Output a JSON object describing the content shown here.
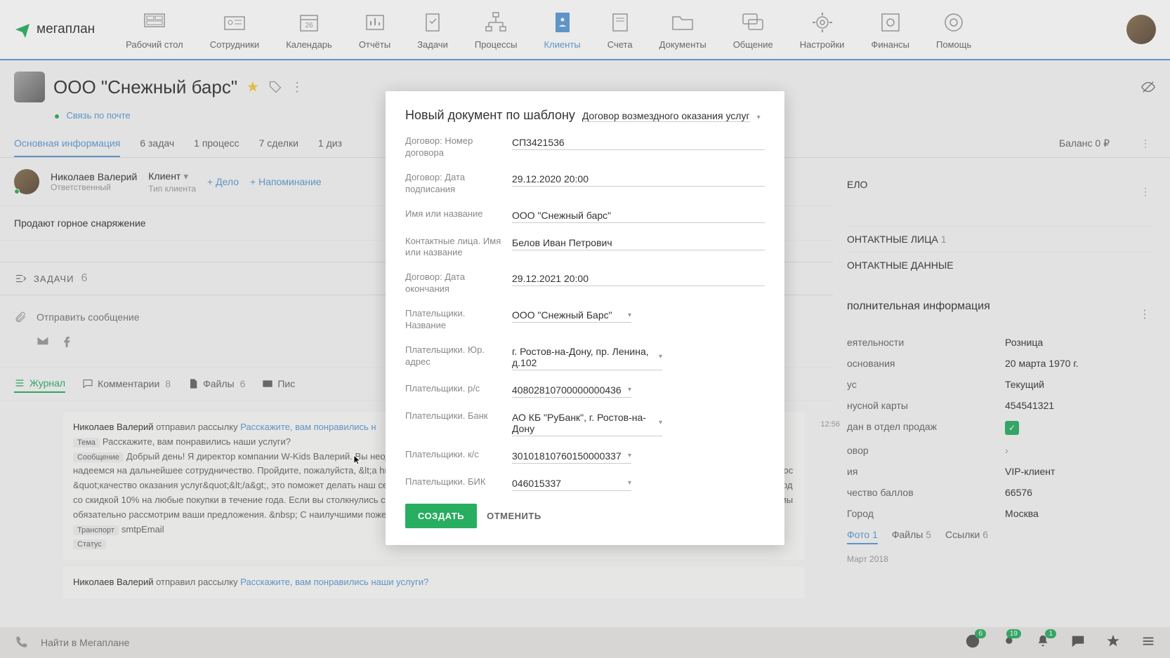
{
  "brand": "мегаплан",
  "nav": {
    "items": [
      {
        "label": "Рабочий стол"
      },
      {
        "label": "Сотрудники"
      },
      {
        "label": "Календарь"
      },
      {
        "label": "Отчёты"
      },
      {
        "label": "Задачи"
      },
      {
        "label": "Процессы"
      },
      {
        "label": "Клиенты"
      },
      {
        "label": "Счета"
      },
      {
        "label": "Документы"
      },
      {
        "label": "Общение"
      },
      {
        "label": "Настройки"
      },
      {
        "label": "Финансы"
      },
      {
        "label": "Помощь"
      }
    ]
  },
  "calendar_badge": "26",
  "client": {
    "name": "ООО \"Снежный барс\"",
    "mail_link": "Связь по почте"
  },
  "tabs": {
    "main": "Основная информация",
    "tasks": "6 задач",
    "process": "1 процесс",
    "deals": "7 сделки",
    "design": "1 диз",
    "balance": "Баланс 0 ₽"
  },
  "responsible": {
    "name": "Николаев Валерий",
    "role": "Ответственный",
    "client_label": "Клиент",
    "client_type": "Тип клиента",
    "add_deal": "+ Дело",
    "add_reminder": "+ Напоминание"
  },
  "description": "Продают горное снаряжение",
  "tasks_section": {
    "label": "ЗАДАЧИ",
    "count": "6"
  },
  "message_placeholder": "Отправить сообщение",
  "feed_tabs": {
    "journal": "Журнал",
    "comments": "Комментарии",
    "comments_count": "8",
    "files": "Файлы",
    "files_count": "6",
    "mail": "Пис"
  },
  "journal": {
    "entry1": {
      "user": "Николаев Валерий",
      "action": " отправил рассылку ",
      "link": "Расскажите, вам понравились н",
      "topic_label": "Тема",
      "topic": "Расскажите, вам понравились наши услуги?",
      "msg_label": "Сообщение",
      "body": "Добрый день! Я директор компании W-Kids Валерий. Вы неоднократно приобретали наши товары. Мы рады, что вы выбрали именно нашу компанию и надеемся на дальнейшее сотрудничество. Пройдите, пожалуйста, &lt;a href=\"https://docs.google.com/forms/d/1e-XG_R9hN0ja5oSlPZ5Vom5nPBBvnoyUomaz_vor.ag\" опрос &quot;качество оказания услуг&quot;&lt;/a&gt;, это поможет делать наш сервис более удобным, а в подарок за потраченное время в конце опроса вы получите промокод со скидкой 10% на любые покупки в течение года. Если вы столкнулись с какими-то проблемами или хотели бы что-то улучшить, то можете ответить на это письмо и мы обязательно рассмотрим ваши предложения. &nbsp; С наилучшими пожеланиями!",
      "transport_label": "Транспорт",
      "transport": "smtpEmail",
      "status_label": "Статус",
      "time": "12:56"
    },
    "entry2": {
      "user": "Николаев Валерий",
      "action": " отправил рассылку ",
      "link": "Расскажите, вам понравились наши услуги?"
    }
  },
  "right": {
    "delo_label": "ЕЛО",
    "contacts_label": "ОНТАКТНЫЕ ЛИЦА",
    "contacts_count": "1",
    "contact_data_label": "ОНТАКТНЫЕ ДАННЫЕ",
    "info_title": "полнительная информация",
    "rows": {
      "activity_label": "еятельности",
      "activity": "Розница",
      "founded_label": "основания",
      "founded": "20 марта 1970 г.",
      "status_label": "ус",
      "status": "Текущий",
      "bonus_label": "нусной карты",
      "bonus": "454541321",
      "sales_label": "дан в отдел продаж",
      "contract_label": "овор",
      "category_label": "ия",
      "category": "VIP-клиент",
      "points_label": "чество баллов",
      "points": "66576",
      "city_label": "Город",
      "city": "Москва"
    },
    "file_tabs": {
      "photo": "Фото",
      "photo_n": "1",
      "files": "Файлы",
      "files_n": "5",
      "links": "Ссылки",
      "links_n": "6"
    },
    "date_group": "Март 2018"
  },
  "modal": {
    "title": "Новый документ по шаблону",
    "template": "Договор возмездного оказания услуг",
    "fields": {
      "number_label": "Договор: Номер договора",
      "number": "СП3421536",
      "sign_date_label": "Договор: Дата подписания",
      "sign_date": "29.12.2020 20:00",
      "name_label": "Имя или название",
      "name": "ООО \"Снежный барс\"",
      "contact_label": "Контактные лица. Имя или название",
      "contact": "Белов Иван Петрович",
      "end_date_label": "Договор: Дата окончания",
      "end_date": "29.12.2021 20:00",
      "payer_name_label": "Плательщики. Название",
      "payer_name": "ООО \"Снежный Барс\"",
      "payer_addr_label": "Плательщики. Юр. адрес",
      "payer_addr": "г. Ростов-на-Дону, пр. Ленина, д.102",
      "payer_acc_label": "Плательщики. р/с",
      "payer_acc": "40802810700000000436",
      "payer_bank_label": "Плательщики. Банк",
      "payer_bank": "АО КБ \"РуБанк\", г. Ростов-на-Дону",
      "payer_ks_label": "Плательщики. к/с",
      "payer_ks": "30101810760150000337",
      "payer_bik_label": "Плательщики. БИК",
      "payer_bik": "046015337"
    },
    "create": "СОЗДАТЬ",
    "cancel": "ОТМЕНИТЬ"
  },
  "bottom": {
    "search_placeholder": "Найти в Мегаплане",
    "badges": {
      "clock": "6",
      "fire": "19",
      "bell": "1"
    }
  }
}
